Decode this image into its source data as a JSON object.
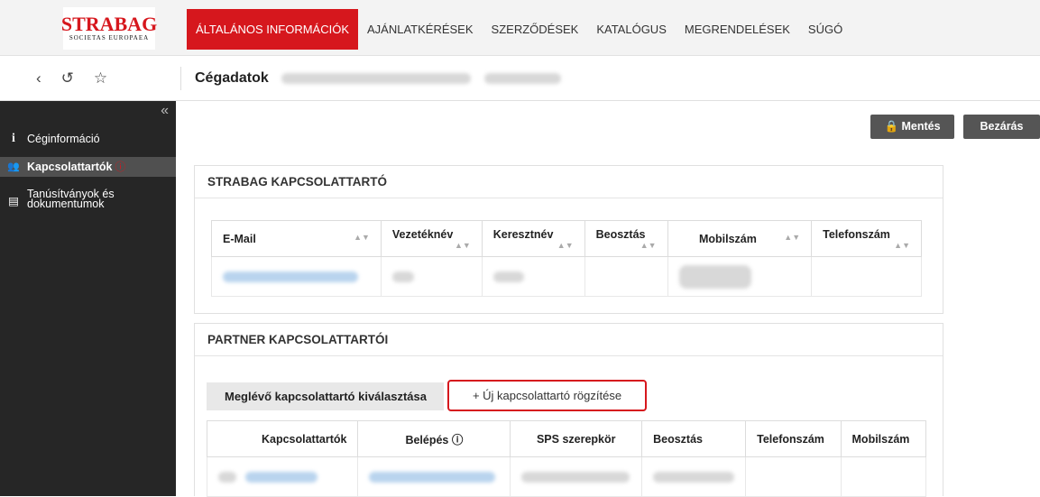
{
  "brand": {
    "name": "STRABAG",
    "sub": "SOCIETAS EUROPAEA",
    "color": "#d6171d"
  },
  "nav": [
    {
      "label": "ÁLTALÁNOS INFORMÁCIÓK",
      "active": true
    },
    {
      "label": "AJÁNLATKÉRÉSEK"
    },
    {
      "label": "SZERZŐDÉSEK"
    },
    {
      "label": "KATALÓGUS"
    },
    {
      "label": "MEGRENDELÉSEK"
    },
    {
      "label": "SÚGÓ"
    }
  ],
  "subbar": {
    "title": "Cégadatok",
    "icons": [
      "back-icon",
      "history-icon",
      "star-icon"
    ]
  },
  "sidebar": {
    "collapse": "«",
    "items": [
      {
        "icon": "i",
        "label": "Céginformáció"
      },
      {
        "icon": "👥",
        "label": "Kapcsolattartók",
        "required": "ⓘ"
      },
      {
        "icon": "▤",
        "label": "Tanúsítványok és dokumentumok"
      }
    ]
  },
  "actions": {
    "save": "🔒 Mentés",
    "close": "Bezárás"
  },
  "strabag_contacts": {
    "title": "STRABAG KAPCSOLATTARTÓ",
    "columns": [
      "E-Mail",
      "Vezetéknév",
      "Keresztnév",
      "Beosztás",
      "Mobilszám",
      "Telefonszám"
    ]
  },
  "partner_contacts": {
    "title": "PARTNER KAPCSOLATTARTÓI",
    "tab_existing": "Meglévő kapcsolattartó kiválasztása",
    "tab_new": "+ Új kapcsolattartó rögzítése",
    "columns": [
      "Kapcsolattartók",
      "Belépés ⓘ",
      "SPS szerepkör",
      "Beosztás",
      "Telefonszám",
      "Mobilszám"
    ]
  }
}
